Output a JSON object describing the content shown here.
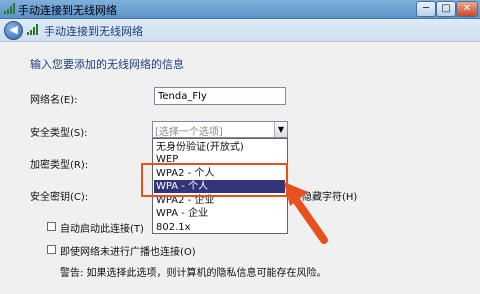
{
  "window": {
    "title": "手动连接到无线网络",
    "minimize_glyph": "─",
    "maximize_glyph": "□",
    "close_glyph": "✕"
  },
  "header": {
    "back_glyph": "◀",
    "title": "手动连接到无线网络"
  },
  "form": {
    "section_title": "输入您要添加的无线网络的信息",
    "network_name_label": "网络名(E):",
    "network_name_value": "Tenda_Fly",
    "security_type_label": "安全类型(S):",
    "security_type_placeholder": "[选择一个选项]",
    "encryption_type_label": "加密类型(R):",
    "security_key_label": "安全密钥(C):",
    "hide_chars_label": "隐藏字符(H)",
    "auto_connect_label": "自动启动此连接(T)",
    "broadcast_label": "即使网络未进行广播也连接(O)",
    "warning_text": "警告: 如果选择此选项，则计算机的隐私信息可能存在风险。"
  },
  "dropdown": {
    "options": [
      "无身份验证(开放式)",
      "WEP",
      "WPA2 - 个人",
      "WPA - 个人",
      "WPA2 - 企业",
      "WPA - 企业",
      "802.1x"
    ],
    "selected_index": 3
  },
  "colors": {
    "annotation": "#e8501d",
    "selected_bg": "#33357a"
  }
}
